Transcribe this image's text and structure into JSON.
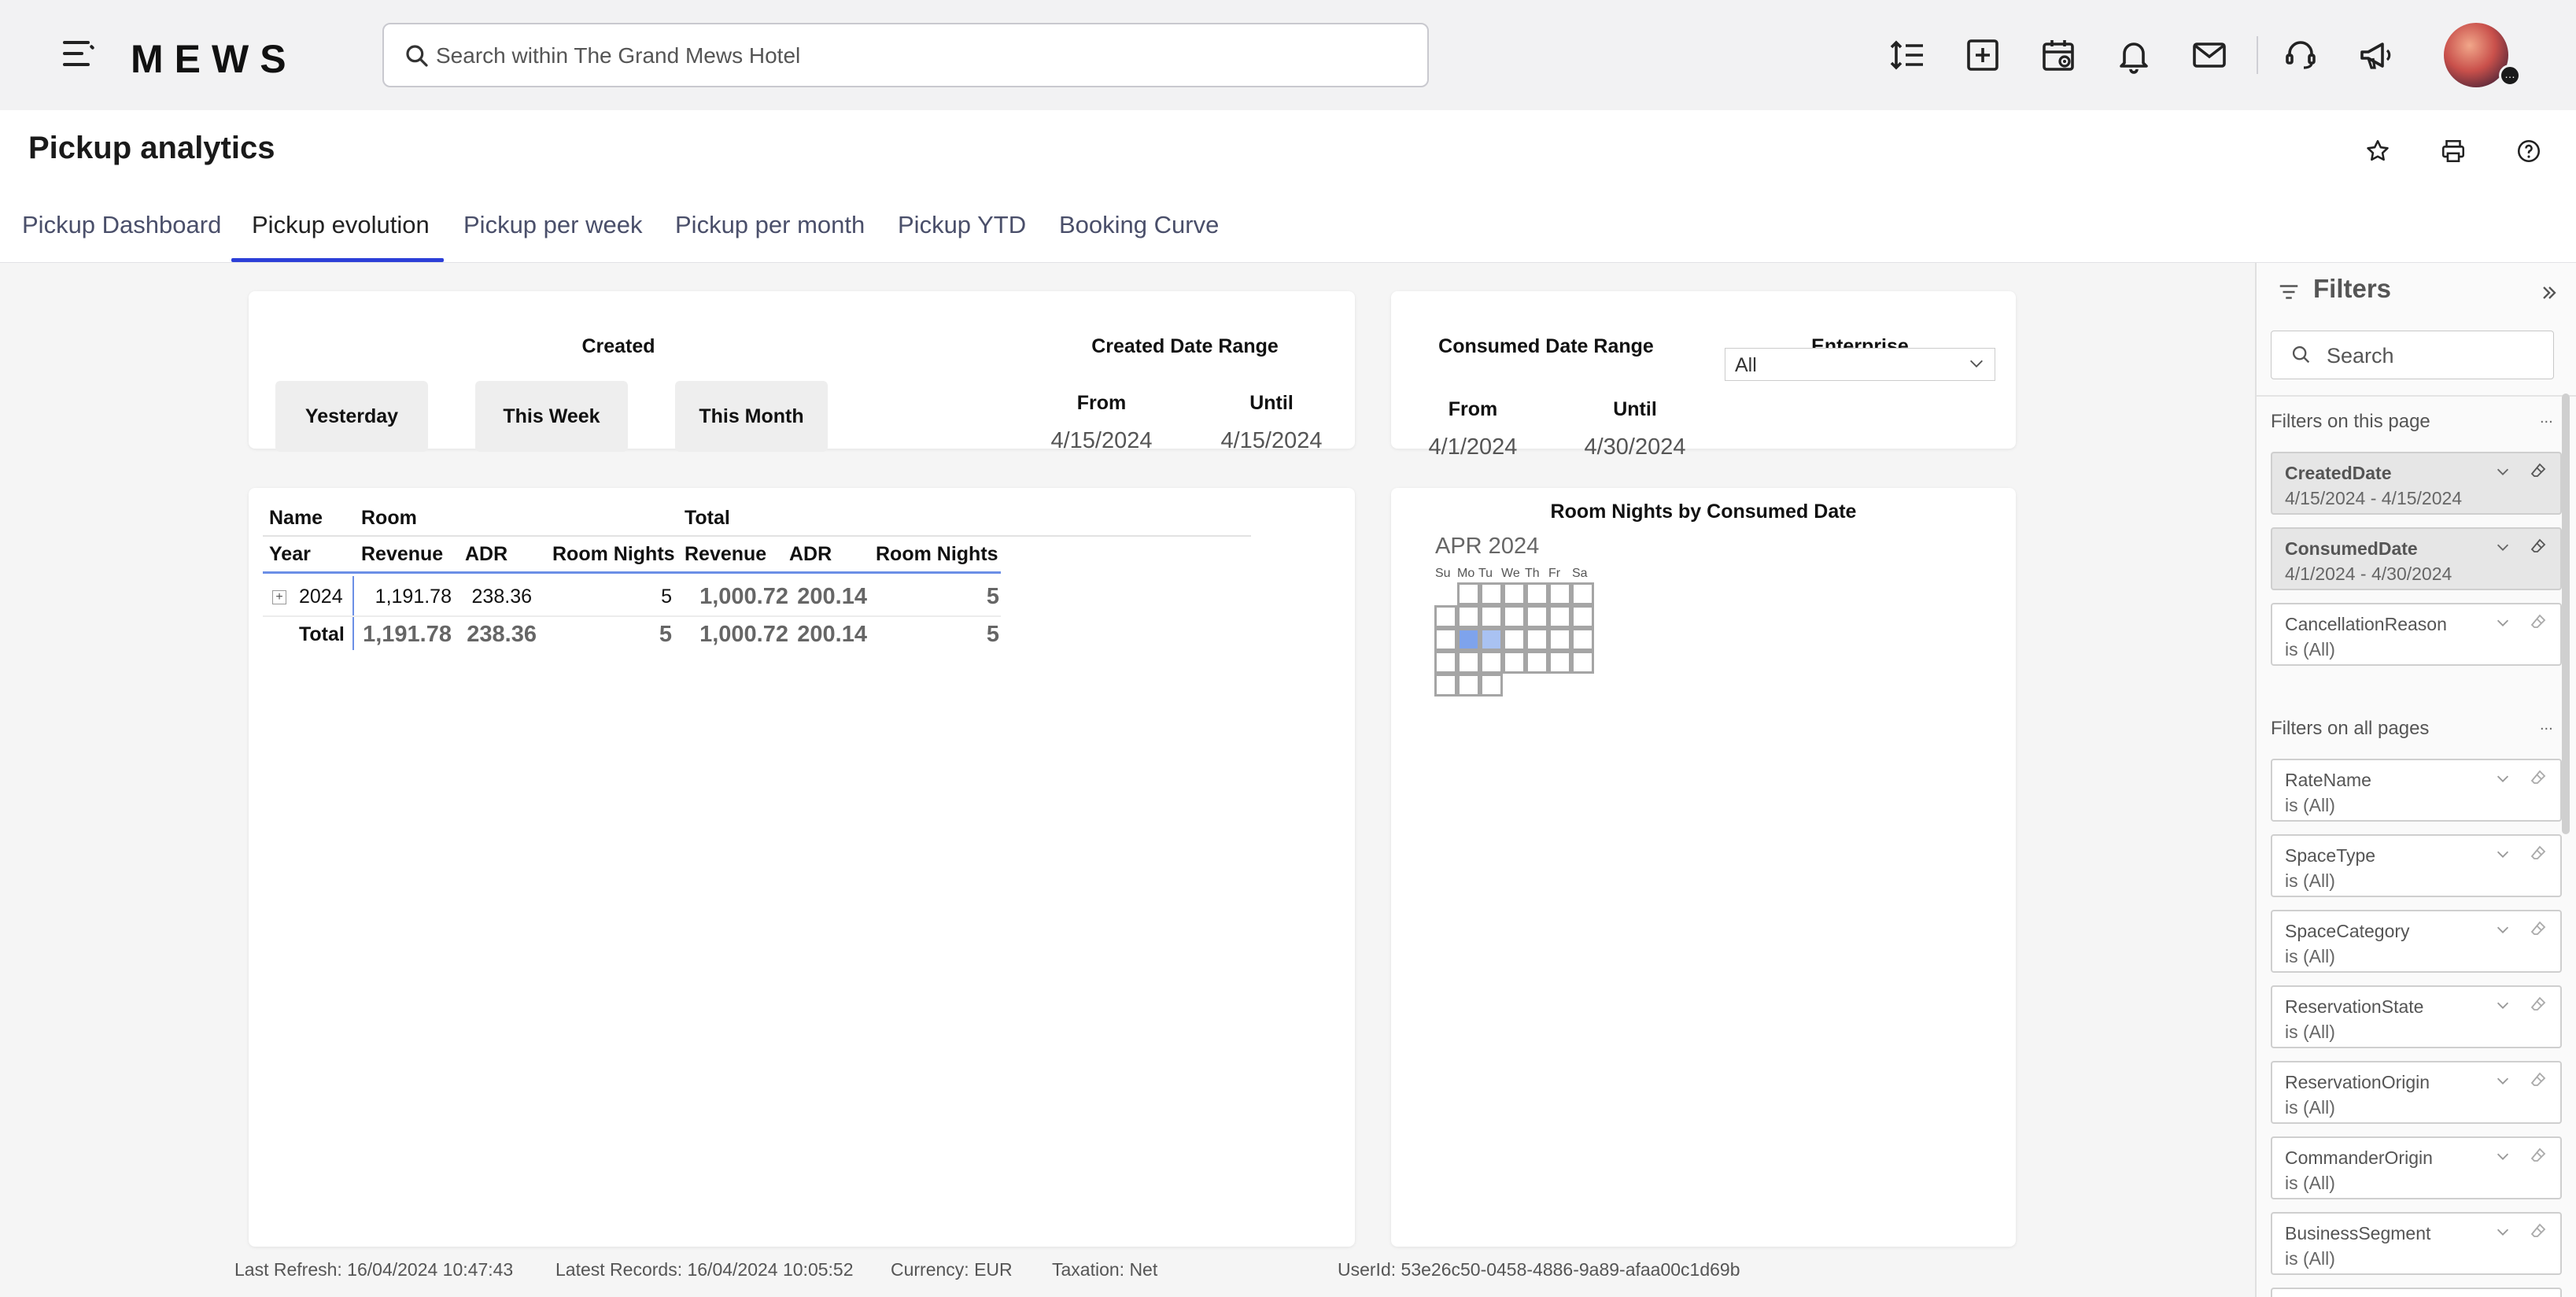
{
  "topbar": {
    "logo": "MEWS",
    "search_placeholder": "Search within The Grand Mews Hotel"
  },
  "page": {
    "title": "Pickup analytics",
    "tabs": [
      "Pickup Dashboard",
      "Pickup evolution",
      "Pickup per week",
      "Pickup per month",
      "Pickup YTD",
      "Booking Curve"
    ],
    "active_tab": "Pickup evolution"
  },
  "slicers": {
    "created_label": "Created",
    "quick_buttons": [
      "Yesterday",
      "This Week",
      "This Month"
    ],
    "created_range": {
      "title": "Created Date Range",
      "from_label": "From",
      "until_label": "Until",
      "from": "4/15/2024",
      "until": "4/15/2024"
    },
    "consumed_range": {
      "title": "Consumed Date Range",
      "from_label": "From",
      "until_label": "Until",
      "from": "4/1/2024",
      "until": "4/30/2024"
    },
    "enterprise": {
      "title": "Enterprise",
      "value": "All"
    }
  },
  "matrix": {
    "group_headers": [
      "Name",
      "Room",
      "Total"
    ],
    "col_headers": [
      "Year",
      "Revenue",
      "ADR",
      "Room Nights",
      "Revenue",
      "ADR",
      "Room Nights"
    ],
    "rows": [
      {
        "label": "2024",
        "values": [
          "1,191.78",
          "238.36",
          "5",
          "1,000.72",
          "200.14",
          "5"
        ]
      }
    ],
    "total": {
      "label": "Total",
      "values": [
        "1,191.78",
        "238.36",
        "5",
        "1,000.72",
        "200.14",
        "5"
      ]
    },
    "expand_symbol": "+"
  },
  "calendar": {
    "title": "Room Nights by Consumed Date",
    "month": "APR 2024",
    "weekdays": [
      "Su",
      "Mo",
      "Tu",
      "We",
      "Th",
      "Fr",
      "Sa"
    ]
  },
  "footer": {
    "last_refresh": "Last Refresh: 16/04/2024 10:47:43",
    "latest_records": "Latest Records: 16/04/2024 10:05:52",
    "currency": "Currency: EUR",
    "taxation": "Taxation: Net",
    "user_id": "UserId: 53e26c50-0458-4886-9a89-afaa00c1d69b"
  },
  "filters": {
    "title": "Filters",
    "search_placeholder": "Search",
    "on_this_page_label": "Filters on this page",
    "on_all_pages_label": "Filters on all pages",
    "more": "...",
    "this_page": [
      {
        "name": "CreatedDate",
        "value": "4/15/2024 - 4/15/2024",
        "active": true
      },
      {
        "name": "ConsumedDate",
        "value": "4/1/2024 - 4/30/2024",
        "active": true
      },
      {
        "name": "CancellationReason",
        "value": "is (All)",
        "active": false
      }
    ],
    "all_pages": [
      {
        "name": "RateName",
        "value": "is (All)"
      },
      {
        "name": "SpaceType",
        "value": "is (All)"
      },
      {
        "name": "SpaceCategory",
        "value": "is (All)"
      },
      {
        "name": "ReservationState",
        "value": "is (All)"
      },
      {
        "name": "ReservationOrigin",
        "value": "is (All)"
      },
      {
        "name": "CommanderOrigin",
        "value": "is (All)"
      },
      {
        "name": "BusinessSegment",
        "value": "is (All)"
      }
    ]
  },
  "icons": [
    "menu-icon",
    "search-icon",
    "line-spacing-icon",
    "add-box-icon",
    "calendar-view-icon",
    "bell-icon",
    "mail-icon",
    "support-icon",
    "megaphone-icon",
    "star-icon",
    "print-icon",
    "help-icon",
    "filter-icon",
    "collapse-icon",
    "chevron-down-icon",
    "eraser-icon"
  ],
  "colors": {
    "accent": "#2c3fd8",
    "calendar_highlight": "#7ea3ec"
  }
}
